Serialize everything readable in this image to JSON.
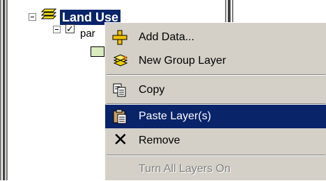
{
  "tree": {
    "root_label": "Land Use",
    "layer_label": "par"
  },
  "context_menu": {
    "items": [
      {
        "label": "Add Data...",
        "icon": "add-data-icon",
        "state": "normal"
      },
      {
        "label": "New Group Layer",
        "icon": "group-layer-icon",
        "state": "normal"
      },
      {
        "label": "Copy",
        "icon": "copy-icon",
        "state": "normal"
      },
      {
        "label": "Paste Layer(s)",
        "icon": "paste-icon",
        "state": "highlighted"
      },
      {
        "label": "Remove",
        "icon": "remove-icon",
        "state": "normal"
      },
      {
        "label": "Turn All Layers On",
        "icon": "",
        "state": "disabled"
      }
    ]
  },
  "colors": {
    "selection": "#0a246a",
    "menu_background": "#d4d0c8",
    "legend_fill": "#d8ecc0"
  }
}
